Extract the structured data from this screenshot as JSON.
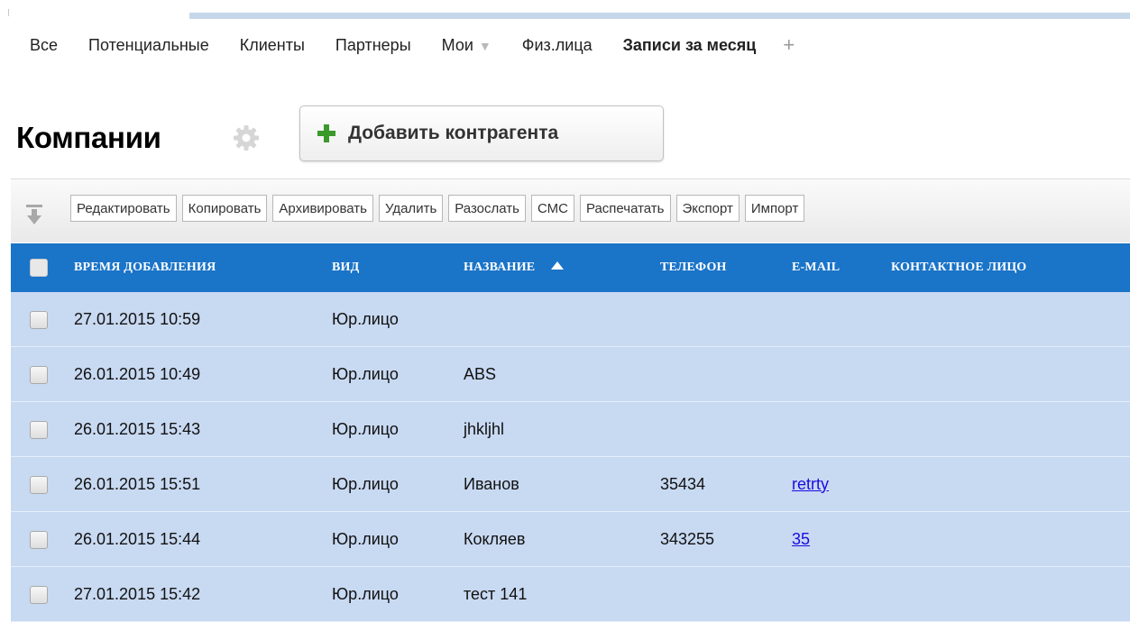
{
  "tabs": [
    {
      "label": "Все"
    },
    {
      "label": "Потенциальные"
    },
    {
      "label": "Клиенты"
    },
    {
      "label": "Партнеры"
    },
    {
      "label": "Мои",
      "dropdown": true
    },
    {
      "label": "Физ.лица"
    },
    {
      "label": "Записи за месяц",
      "active": true
    }
  ],
  "tab_add": "+",
  "page_title": "Компании",
  "add_button": "Добавить контрагента",
  "toolbar": {
    "buttons": [
      "Редактировать",
      "Копировать",
      "Архивировать",
      "Удалить",
      "Разослать",
      "СМС",
      "Распечатать",
      "Экспорт",
      "Импорт"
    ]
  },
  "table": {
    "columns": [
      "ВРЕМЯ ДОБАВЛЕНИЯ",
      "ВИД",
      "НАЗВАНИЕ",
      "ТЕЛЕФОН",
      "E-MAIL",
      "КОНТАКТНОЕ ЛИЦО"
    ],
    "sort_column": "НАЗВАНИЕ",
    "rows": [
      {
        "time": "27.01.2015 10:59",
        "type": "Юр.лицо",
        "name": "",
        "phone": "",
        "email": "",
        "contact": ""
      },
      {
        "time": "26.01.2015 10:49",
        "type": "Юр.лицо",
        "name": "ABS",
        "phone": "",
        "email": "",
        "contact": ""
      },
      {
        "time": "26.01.2015 15:43",
        "type": "Юр.лицо",
        "name": "jhkljhl",
        "phone": "",
        "email": "",
        "contact": ""
      },
      {
        "time": "26.01.2015 15:51",
        "type": "Юр.лицо",
        "name": "Иванов",
        "phone": "35434",
        "email": "retrty",
        "contact": ""
      },
      {
        "time": "26.01.2015 15:44",
        "type": "Юр.лицо",
        "name": "Кокляев",
        "phone": "343255",
        "email": "35",
        "contact": ""
      },
      {
        "time": "27.01.2015 15:42",
        "type": "Юр.лицо",
        "name": "тест 141",
        "phone": "",
        "email": "",
        "contact": ""
      }
    ]
  },
  "colors": {
    "header_bg": "#1a74c8",
    "row_bg": "#c8d9f2",
    "link": "#1a0dde",
    "plus_green": "#3a9a2a"
  }
}
